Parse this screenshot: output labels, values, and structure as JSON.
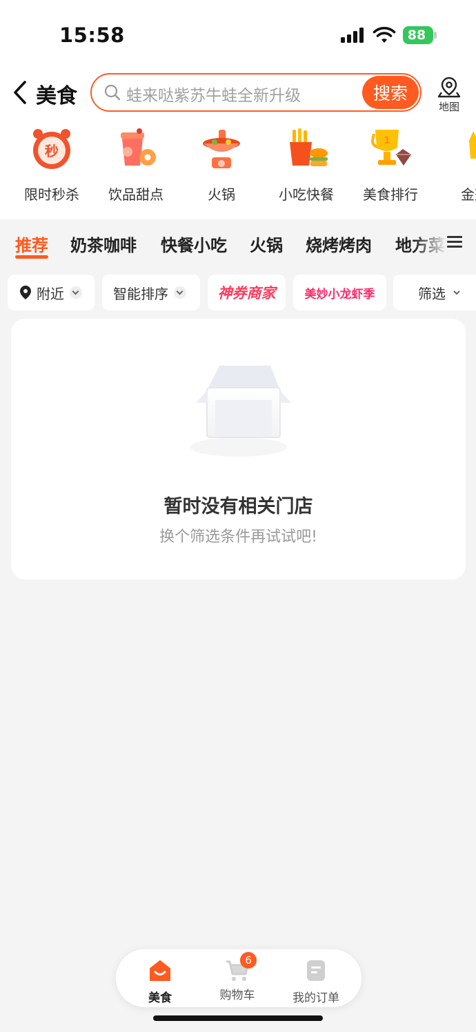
{
  "status_bar": {
    "time": "15:58",
    "battery": "88"
  },
  "header": {
    "title": "美食",
    "search_placeholder": "蛙来哒紫苏牛蛙全新升级",
    "search_button": "搜索",
    "map_label": "地图"
  },
  "categories": [
    {
      "label": "限时秒杀",
      "icon": "flash-sale-clock-icon"
    },
    {
      "label": "饮品甜点",
      "icon": "drinks-dessert-icon"
    },
    {
      "label": "火锅",
      "icon": "hotpot-icon"
    },
    {
      "label": "小吃快餐",
      "icon": "fries-burger-icon"
    },
    {
      "label": "美食排行",
      "icon": "trophy-icon"
    },
    {
      "label": "金冠",
      "icon": "gold-crown-icon"
    }
  ],
  "tabs": [
    "推荐",
    "奶茶咖啡",
    "快餐小吃",
    "火锅",
    "烧烤烤肉",
    "地方菜"
  ],
  "filters": {
    "nearby": "附近",
    "sort": "智能排序",
    "promo1": "神券商家",
    "promo2": "美妙小龙虾季",
    "filter": "筛选"
  },
  "empty_state": {
    "title": "暂时没有相关门店",
    "subtitle": "换个筛选条件再试试吧!"
  },
  "bottom_nav": {
    "items": [
      {
        "label": "美食",
        "icon": "home-icon"
      },
      {
        "label": "购物车",
        "icon": "cart-icon",
        "badge": "6"
      },
      {
        "label": "我的订单",
        "icon": "order-icon"
      }
    ]
  },
  "colors": {
    "accent": "#ff5a1f",
    "background": "#f4f4f4"
  }
}
